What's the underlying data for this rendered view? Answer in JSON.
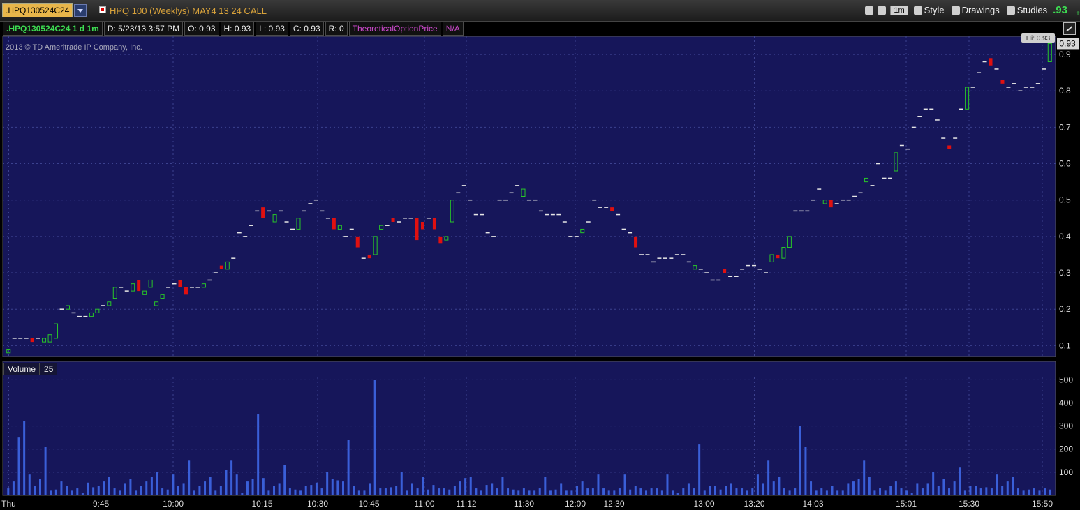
{
  "header": {
    "symbol": ".HPQ130524C24",
    "description": "HPQ 100 (Weeklys) MAY4 13 24 CALL",
    "aggregation": "1m",
    "style_label": "Style",
    "drawings_label": "Drawings",
    "studies_label": "Studies",
    "last_price": ".93",
    "change_prefix": "+"
  },
  "info": {
    "symbol_period": ".HPQ130524C24 1 d 1m",
    "date": "D: 5/23/13 3:57 PM",
    "open": "O: 0.93",
    "high": "H: 0.93",
    "low": "L: 0.93",
    "close": "C: 0.93",
    "range": "R: 0",
    "study": "TheoreticalOptionPrice",
    "study_value": "N/A"
  },
  "copyright": "2013 © TD Ameritrade IP Company, Inc.",
  "volume_panel": {
    "label": "Volume",
    "value": "25"
  },
  "colors": {
    "background": "#16165a",
    "grid": "#3c4290",
    "up": "#28c828",
    "down": "#e01010",
    "flat": "#e6e6e6",
    "volume": "#3a5fd8"
  },
  "chart_data": [
    {
      "type": "candlestick",
      "title": "",
      "ylim": [
        0.07,
        0.95
      ],
      "yticks": [
        "0.1",
        "0.2",
        "0.3",
        "0.4",
        "0.5",
        "0.6",
        "0.7",
        "0.8",
        "0.9"
      ],
      "price_tag": "0.93",
      "high_tag": "Hi: 0.93",
      "grid": true,
      "prices": [
        0.09,
        0.12,
        0.12,
        0.12,
        0.11,
        0.12,
        0.12,
        0.13,
        0.16,
        0.2,
        0.21,
        0.19,
        0.18,
        0.18,
        0.19,
        0.2,
        0.21,
        0.22,
        0.26,
        0.26,
        0.25,
        0.27,
        0.25,
        0.25,
        0.28,
        0.22,
        0.24,
        0.26,
        0.27,
        0.26,
        0.24,
        0.26,
        0.26,
        0.27,
        0.28,
        0.3,
        0.31,
        0.33,
        0.34,
        0.41,
        0.4,
        0.43,
        0.47,
        0.45,
        0.47,
        0.46,
        0.47,
        0.44,
        0.42,
        0.45,
        0.47,
        0.49,
        0.5,
        0.47,
        0.45,
        0.42,
        0.43,
        0.4,
        0.42,
        0.37,
        0.34,
        0.34,
        0.4,
        0.43,
        0.43,
        0.44,
        0.44,
        0.45,
        0.45,
        0.39,
        0.42,
        0.45,
        0.42,
        0.38,
        0.4,
        0.5,
        0.52,
        0.54,
        0.5,
        0.46,
        0.46,
        0.41,
        0.4,
        0.5,
        0.5,
        0.52,
        0.54,
        0.53,
        0.5,
        0.5,
        0.47,
        0.46,
        0.46,
        0.46,
        0.44,
        0.4,
        0.4,
        0.42,
        0.44,
        0.5,
        0.48,
        0.48,
        0.47,
        0.46,
        0.42,
        0.41,
        0.37,
        0.35,
        0.35,
        0.33,
        0.34,
        0.34,
        0.34,
        0.35,
        0.35,
        0.33,
        0.32,
        0.31,
        0.3,
        0.28,
        0.28,
        0.3,
        0.29,
        0.29,
        0.31,
        0.32,
        0.32,
        0.31,
        0.3,
        0.35,
        0.34,
        0.37,
        0.4,
        0.47,
        0.47,
        0.47,
        0.5,
        0.53,
        0.5,
        0.48,
        0.49,
        0.5,
        0.5,
        0.51,
        0.52,
        0.56,
        0.54,
        0.6,
        0.56,
        0.56,
        0.63,
        0.65,
        0.64,
        0.7,
        0.73,
        0.75,
        0.75,
        0.72,
        0.67,
        0.64,
        0.67,
        0.75,
        0.81,
        0.81,
        0.85,
        0.88,
        0.87,
        0.86,
        0.82,
        0.81,
        0.82,
        0.8,
        0.81,
        0.81,
        0.82,
        0.86,
        0.93
      ],
      "opens": [
        0.08,
        0.12,
        0.12,
        0.12,
        0.12,
        0.12,
        0.11,
        0.11,
        0.12,
        0.2,
        0.2,
        0.19,
        0.18,
        0.18,
        0.18,
        0.19,
        0.21,
        0.21,
        0.23,
        0.26,
        0.25,
        0.25,
        0.28,
        0.24,
        0.26,
        0.21,
        0.23,
        0.26,
        0.27,
        0.28,
        0.26,
        0.26,
        0.26,
        0.26,
        0.28,
        0.3,
        0.32,
        0.31,
        0.34,
        0.41,
        0.4,
        0.43,
        0.47,
        0.48,
        0.47,
        0.44,
        0.47,
        0.44,
        0.42,
        0.42,
        0.47,
        0.49,
        0.5,
        0.47,
        0.45,
        0.45,
        0.42,
        0.4,
        0.42,
        0.4,
        0.34,
        0.35,
        0.35,
        0.42,
        0.43,
        0.45,
        0.44,
        0.45,
        0.45,
        0.45,
        0.44,
        0.45,
        0.45,
        0.4,
        0.39,
        0.44,
        0.52,
        0.54,
        0.5,
        0.46,
        0.46,
        0.41,
        0.4,
        0.5,
        0.5,
        0.52,
        0.54,
        0.51,
        0.5,
        0.5,
        0.47,
        0.46,
        0.46,
        0.46,
        0.44,
        0.4,
        0.4,
        0.41,
        0.44,
        0.5,
        0.48,
        0.48,
        0.48,
        0.46,
        0.42,
        0.41,
        0.4,
        0.35,
        0.35,
        0.33,
        0.34,
        0.34,
        0.34,
        0.35,
        0.35,
        0.33,
        0.31,
        0.31,
        0.3,
        0.28,
        0.28,
        0.31,
        0.29,
        0.29,
        0.31,
        0.32,
        0.32,
        0.31,
        0.3,
        0.33,
        0.35,
        0.34,
        0.37,
        0.47,
        0.47,
        0.47,
        0.5,
        0.53,
        0.49,
        0.5,
        0.49,
        0.5,
        0.5,
        0.51,
        0.52,
        0.55,
        0.54,
        0.6,
        0.56,
        0.56,
        0.58,
        0.65,
        0.64,
        0.7,
        0.73,
        0.75,
        0.75,
        0.72,
        0.67,
        0.65,
        0.67,
        0.75,
        0.75,
        0.81,
        0.85,
        0.88,
        0.89,
        0.86,
        0.83,
        0.81,
        0.82,
        0.8,
        0.81,
        0.81,
        0.82,
        0.86,
        0.88
      ],
      "volume_ylim": [
        0,
        510
      ],
      "volume_yticks": [
        "100",
        "200",
        "300",
        "400",
        "500"
      ],
      "volumes": [
        30,
        60,
        250,
        320,
        90,
        40,
        70,
        210,
        20,
        25,
        60,
        40,
        20,
        30,
        10,
        55,
        35,
        40,
        60,
        80,
        30,
        20,
        50,
        70,
        20,
        40,
        60,
        80,
        100,
        30,
        25,
        90,
        40,
        50,
        150,
        20,
        40,
        60,
        80,
        20,
        40,
        110,
        150,
        90,
        10,
        60,
        70,
        350,
        75,
        20,
        40,
        50,
        130,
        30,
        25,
        20,
        40,
        45,
        55,
        30,
        100,
        70,
        65,
        60,
        240,
        40,
        20,
        20,
        50,
        500,
        30,
        30,
        35,
        40,
        100,
        20,
        50,
        30,
        80,
        25,
        45,
        30,
        30,
        25,
        40,
        60,
        75,
        80,
        30,
        20,
        45,
        50,
        30,
        80,
        30,
        25,
        20,
        30,
        20,
        20,
        30,
        80,
        20,
        25,
        50,
        20,
        20,
        40,
        60,
        30,
        30,
        90,
        30,
        20,
        20,
        30,
        90,
        25,
        40,
        30,
        20,
        30,
        30,
        20,
        90,
        20,
        10,
        30,
        50,
        30,
        220,
        20,
        40,
        40,
        25,
        40,
        50,
        30,
        30,
        20,
        30,
        90,
        50,
        150,
        60,
        80,
        30,
        20,
        30,
        300,
        210,
        60,
        20,
        30,
        20,
        40,
        20,
        20,
        50,
        60,
        70,
        150,
        80,
        20,
        30,
        20,
        40,
        60,
        30,
        20,
        10,
        50,
        30,
        50,
        100,
        40,
        70,
        30,
        60,
        120,
        20,
        40,
        40,
        30,
        35,
        30,
        90,
        40,
        60,
        80,
        30,
        20,
        25,
        30,
        20,
        30,
        25
      ],
      "xticks": [
        {
          "label": "Thu",
          "frac": 0.003
        },
        {
          "label": "9:45",
          "frac": 0.091
        },
        {
          "label": "10:00",
          "frac": 0.16
        },
        {
          "label": "10:15",
          "frac": 0.245
        },
        {
          "label": "10:30",
          "frac": 0.298
        },
        {
          "label": "10:45",
          "frac": 0.347
        },
        {
          "label": "11:00",
          "frac": 0.4
        },
        {
          "label": "11:12",
          "frac": 0.44
        },
        {
          "label": "11:30",
          "frac": 0.495
        },
        {
          "label": "12:00",
          "frac": 0.544
        },
        {
          "label": "12:30",
          "frac": 0.581
        },
        {
          "label": "13:00",
          "frac": 0.667
        },
        {
          "label": "13:20",
          "frac": 0.715
        },
        {
          "label": "14:03",
          "frac": 0.771
        },
        {
          "label": "15:01",
          "frac": 0.86
        },
        {
          "label": "15:30",
          "frac": 0.92
        },
        {
          "label": "15:50",
          "frac": 0.99
        }
      ]
    }
  ]
}
